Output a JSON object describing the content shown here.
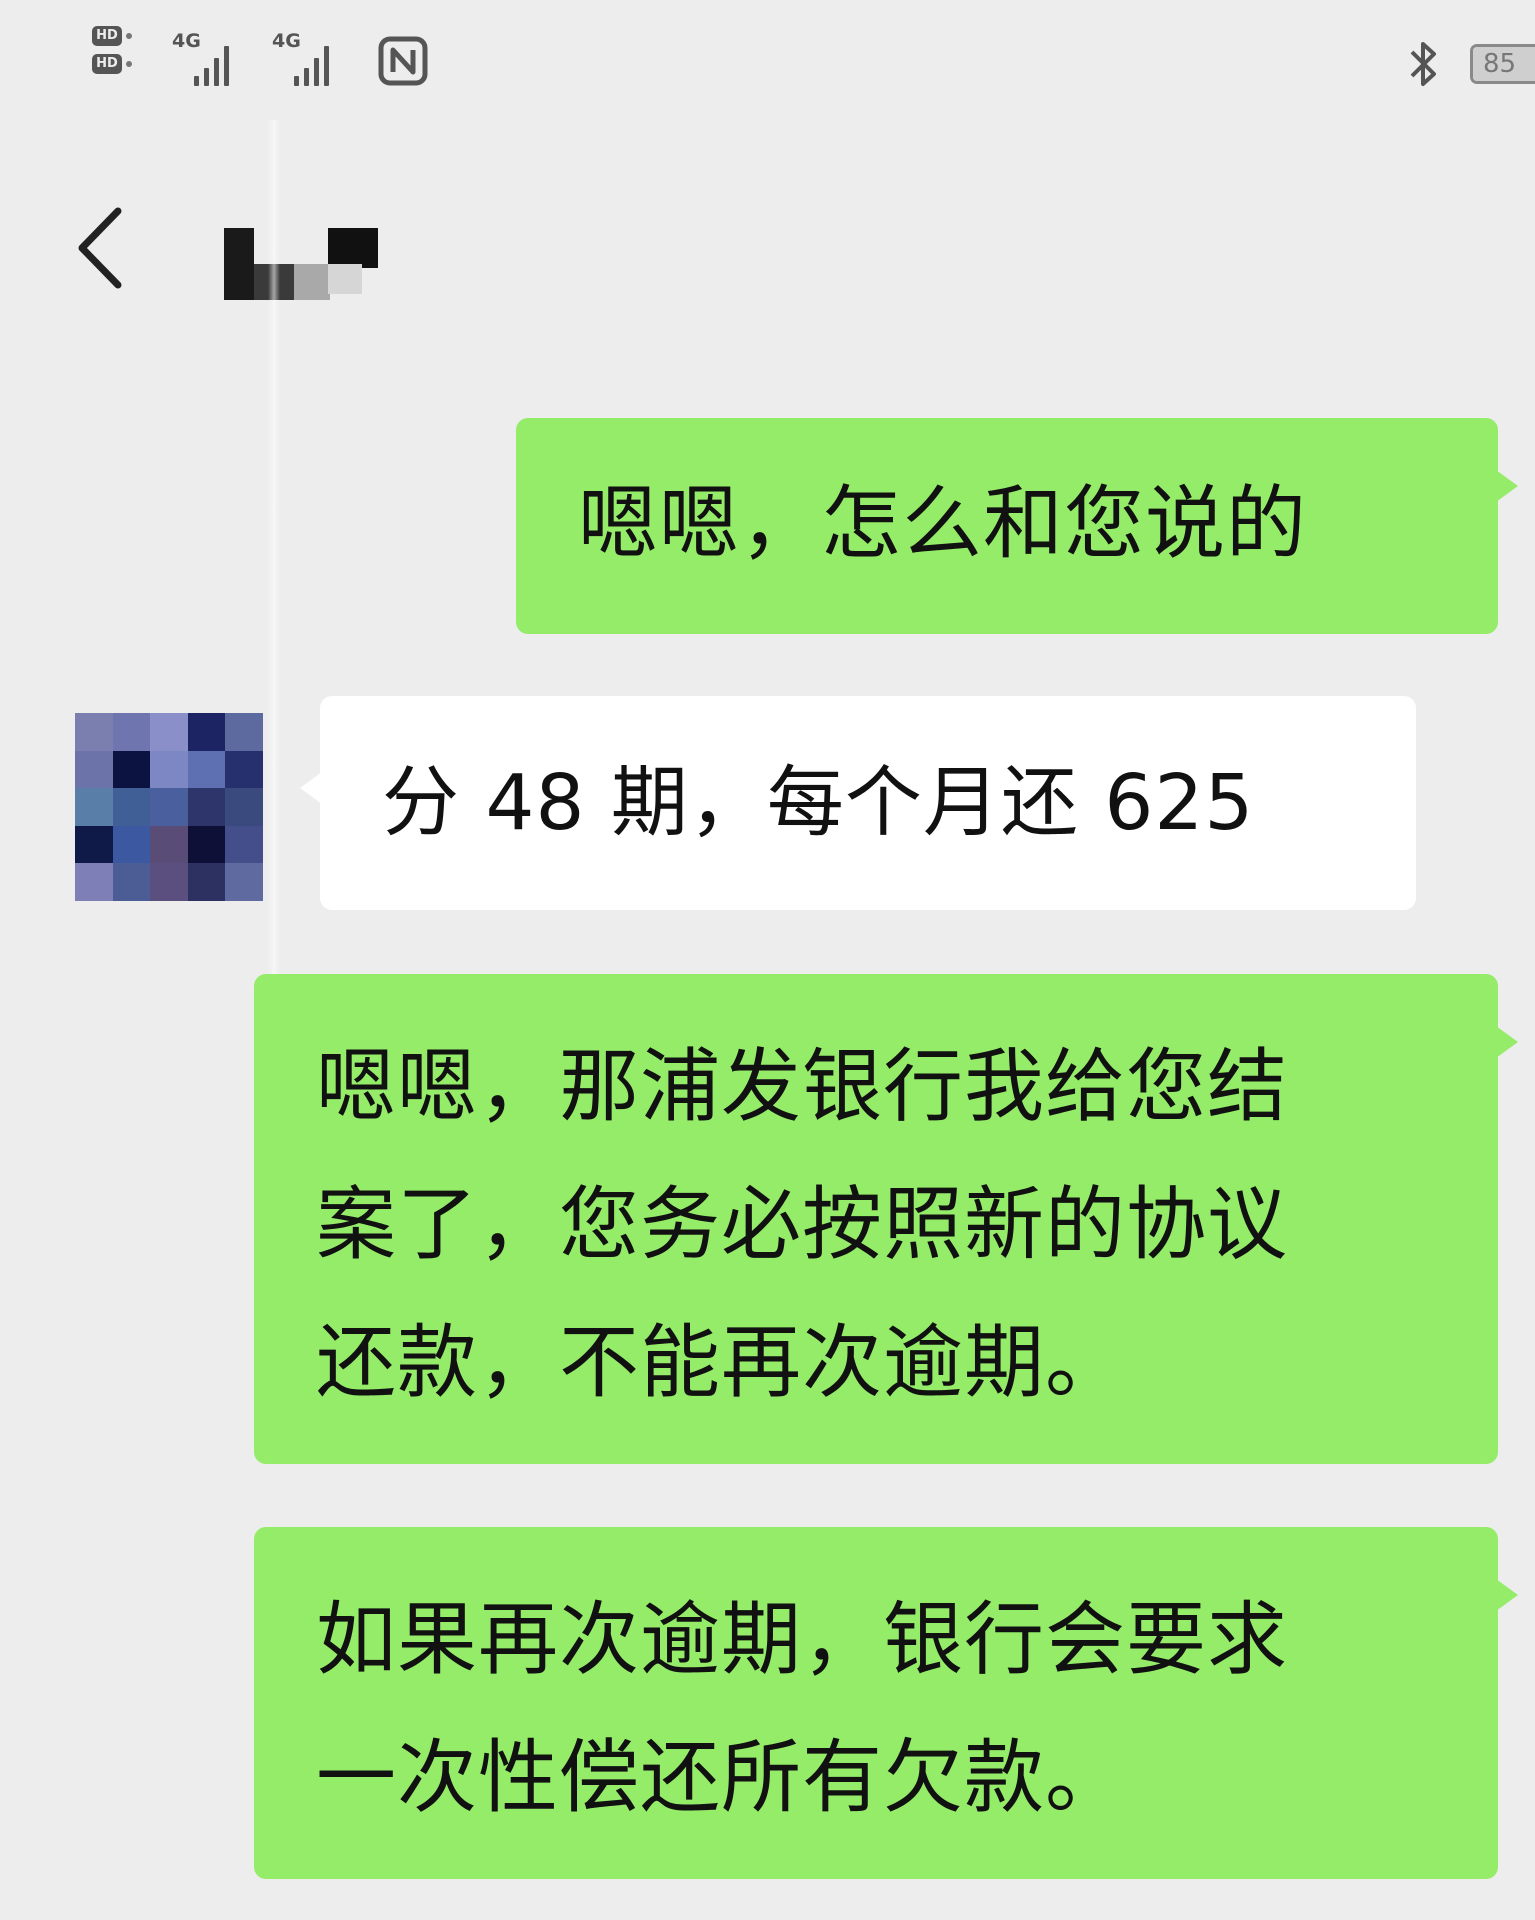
{
  "status_bar": {
    "sim_badges": [
      "HD",
      "HD"
    ],
    "signal_1_label": "4G",
    "signal_2_label": "4G",
    "battery_percent": "85",
    "battery_level": 0.85,
    "icons": [
      "signal-icon",
      "signal-icon",
      "nfc-icon",
      "bluetooth-icon",
      "battery-icon"
    ]
  },
  "header": {
    "back_icon": "chevron-left-icon",
    "contact_name_redacted": true
  },
  "messages": [
    {
      "sender": "me",
      "text": "嗯嗯，怎么和您说的"
    },
    {
      "sender": "them",
      "text": "分 48 期，每个月还 625"
    },
    {
      "sender": "me",
      "text": "嗯嗯，那浦发银行我给您结\n案了，您务必按照新的协议\n还款，不能再次逾期。"
    },
    {
      "sender": "me",
      "text": "如果再次逾期，银行会要求\n一次性偿还所有欠款。"
    }
  ],
  "colors": {
    "background": "#ededed",
    "outgoing_bubble": "#95ec69",
    "incoming_bubble": "#ffffff"
  }
}
